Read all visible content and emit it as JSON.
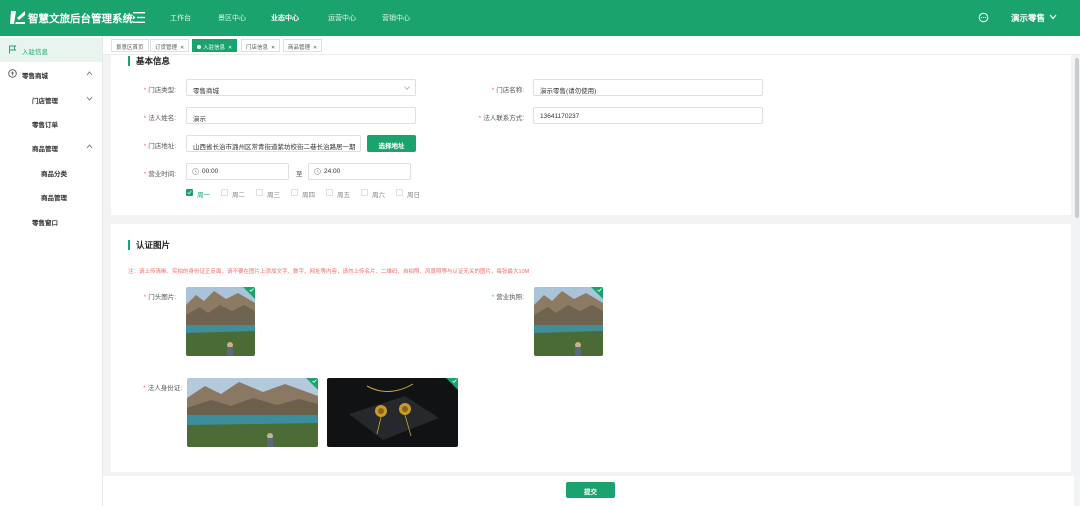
{
  "app": {
    "title": "智慧文旅后台管理系统",
    "user": "演示零售",
    "nav": [
      "工作台",
      "景区中心",
      "业态中心",
      "运营中心",
      "营销中心"
    ],
    "nav_active": "业态中心"
  },
  "sidebar": {
    "items": [
      {
        "label": "入驻信息"
      },
      {
        "label": "零售商城"
      },
      {
        "label": "门店管理"
      },
      {
        "label": "零售订单"
      },
      {
        "label": "商品管理"
      },
      {
        "label": "商品分类"
      },
      {
        "label": "商品管理"
      },
      {
        "label": "零售窗口"
      }
    ]
  },
  "tabs": [
    {
      "label": "景意区首页"
    },
    {
      "label": "订货管理"
    },
    {
      "label": "入驻信息"
    },
    {
      "label": "门店信息"
    },
    {
      "label": "商品管理"
    }
  ],
  "basic": {
    "title": "基本信息",
    "store_type": {
      "label": "门店类型:",
      "value": "零售商城"
    },
    "store_name": {
      "label": "门店名称:",
      "value": "演示零售(请勿使用)"
    },
    "legal_name": {
      "label": "法人姓名:",
      "value": "演示"
    },
    "legal_phone": {
      "label": "法人联系方式:",
      "value": "13641170237"
    },
    "address": {
      "label": "门店地址:",
      "value": "山西省长治市潞州区常青街道紫坊校街二巷长治路居一期",
      "button": "选择地址"
    },
    "hours": {
      "label": "营业时间:",
      "start": "00:00",
      "sep": "至",
      "end": "24:00"
    },
    "days": [
      {
        "label": "周一",
        "checked": true
      },
      {
        "label": "周二",
        "checked": false
      },
      {
        "label": "周三",
        "checked": false
      },
      {
        "label": "周四",
        "checked": false
      },
      {
        "label": "周五",
        "checked": false
      },
      {
        "label": "周六",
        "checked": false
      },
      {
        "label": "周日",
        "checked": false
      }
    ]
  },
  "cert": {
    "title": "认证图片",
    "note": "注：请上传清晰、实拍的身份证正反面，请不要在图片上添加文字、数字、网址等内容，请勿上传名片、二维码、自拍照、风景照等与认证无关的图片，每张最大10M",
    "storefront_label": "门头图片:",
    "license_label": "营业执照:",
    "id_label": "法人身份证:"
  },
  "submit_label": "提交",
  "colors": {
    "primary": "#1aa36d",
    "danger": "#f56c6c"
  }
}
